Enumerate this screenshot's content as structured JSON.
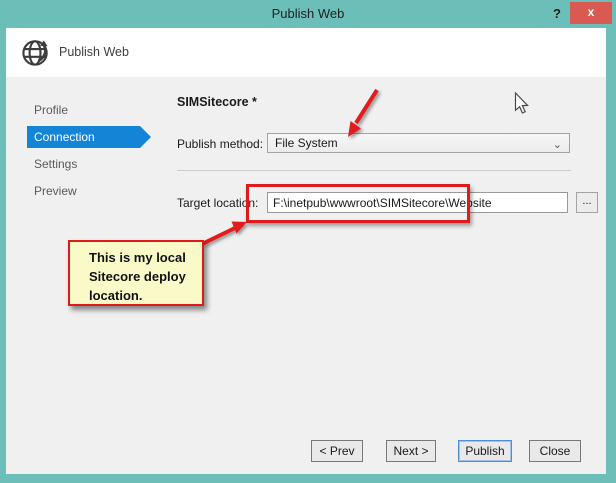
{
  "window": {
    "title": "Publish Web",
    "help_label": "?",
    "close_glyph": "x"
  },
  "header": {
    "title": "Publish Web"
  },
  "sidebar": {
    "items": [
      {
        "label": "Profile",
        "selected": false
      },
      {
        "label": "Connection",
        "selected": true
      },
      {
        "label": "Settings",
        "selected": false
      },
      {
        "label": "Preview",
        "selected": false
      }
    ]
  },
  "form": {
    "profile_name": "SIMSitecore *",
    "publish_method_label": "Publish method:",
    "publish_method_value": "File System",
    "chevron_glyph": "⌄",
    "target_location_label": "Target location:",
    "target_location_value": "F:\\inetpub\\wwwroot\\SIMSitecore\\Website",
    "browse_label": "..."
  },
  "annotations": {
    "note_text": "This is my local Sitecore deploy location.",
    "annotation_red": "#e01a1a",
    "note_bg": "#fafac8"
  },
  "footer": {
    "prev_label": "< Prev",
    "next_label": "Next >",
    "publish_label": "Publish",
    "close_label": "Close"
  },
  "colors": {
    "titlebar_teal": "#6cbfb9",
    "close_red": "#d95953",
    "accent_blue": "#1484d7",
    "body_gray": "#f0f0f0"
  }
}
